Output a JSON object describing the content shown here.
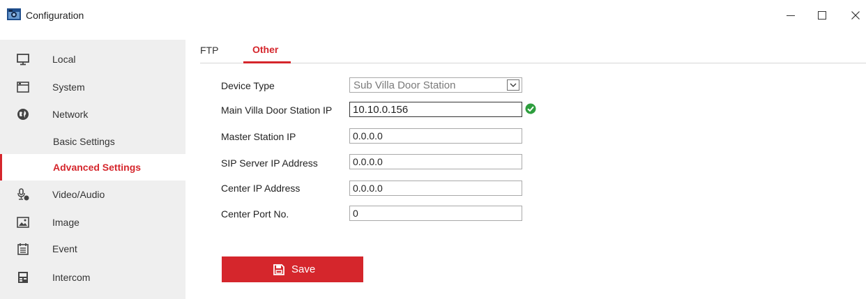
{
  "window": {
    "title": "Configuration",
    "icon": "camera-app-icon",
    "controls": [
      "minimize-icon",
      "maximize-icon",
      "close-icon"
    ]
  },
  "sidebar": {
    "items": [
      {
        "label": "Local",
        "icon": "monitor-icon"
      },
      {
        "label": "System",
        "icon": "system-window-icon"
      },
      {
        "label": "Network",
        "icon": "globe-icon"
      },
      {
        "label": "Basic Settings",
        "sub": true
      },
      {
        "label": "Advanced Settings",
        "sub": true,
        "active": true
      },
      {
        "label": "Video/Audio",
        "icon": "microphone-icon"
      },
      {
        "label": "Image",
        "icon": "image-icon"
      },
      {
        "label": "Event",
        "icon": "calendar-icon"
      },
      {
        "label": "Intercom",
        "icon": "intercom-icon"
      }
    ]
  },
  "tabs": [
    {
      "label": "FTP",
      "active": false
    },
    {
      "label": "Other",
      "active": true
    }
  ],
  "form": {
    "device_type": {
      "label": "Device Type",
      "value": "Sub Villa Door Station"
    },
    "main_villa_ip": {
      "label": "Main Villa Door Station IP",
      "value": "10.10.0.156",
      "valid": true
    },
    "master_station_ip": {
      "label": "Master Station IP",
      "value": "0.0.0.0"
    },
    "sip_server_ip": {
      "label": "SIP Server IP Address",
      "value": "0.0.0.0"
    },
    "center_ip": {
      "label": "Center IP Address",
      "value": "0.0.0.0"
    },
    "center_port": {
      "label": "Center Port No.",
      "value": "0"
    }
  },
  "save": {
    "label": "Save",
    "icon": "floppy-disk-icon"
  },
  "colors": {
    "accent": "#d5262c",
    "sidebar_bg": "#efefef",
    "valid": "#2e9e3e"
  }
}
